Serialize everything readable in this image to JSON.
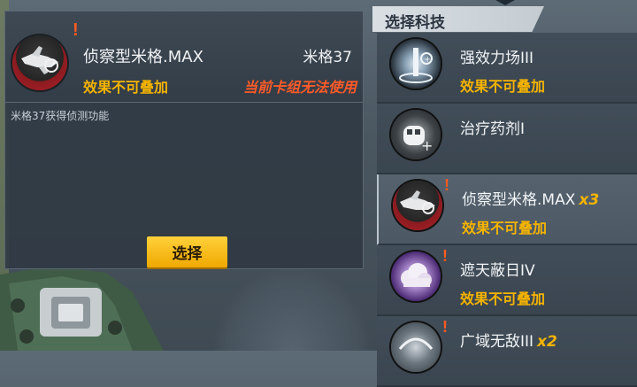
{
  "detail": {
    "name": "侦察型米格.MAX",
    "mech_name": "米格37",
    "no_stack": "效果不可叠加",
    "warning": "当前卡组无法使用",
    "description": "米格37获得侦测功能",
    "select_label": "选择",
    "alert_mark": "!"
  },
  "list": {
    "title": "选择科技",
    "items": [
      {
        "name": "强效力场III",
        "count": "",
        "status": "效果不可叠加",
        "alert": "",
        "icon": "force-field-icon",
        "selected": false
      },
      {
        "name": "治疗药剂I",
        "count": "",
        "status": "",
        "alert": "",
        "icon": "healing-potion-icon",
        "selected": false
      },
      {
        "name": "侦察型米格.MAX",
        "count": "x3",
        "status": "效果不可叠加",
        "alert": "!",
        "icon": "recon-mig-icon",
        "selected": true
      },
      {
        "name": "遮天蔽日IV",
        "count": "",
        "status": "效果不可叠加",
        "alert": "!",
        "icon": "smoke-cloud-icon",
        "selected": false
      },
      {
        "name": "广域无敌III",
        "count": "x2",
        "status": "",
        "alert": "!",
        "icon": "wide-invincible-icon",
        "selected": false
      }
    ]
  },
  "colors": {
    "accent_yellow": "#f6b400",
    "warning_red": "#ff5a28",
    "alert_orange": "#ff5a1f",
    "button_yellow": "#ffc21a"
  }
}
